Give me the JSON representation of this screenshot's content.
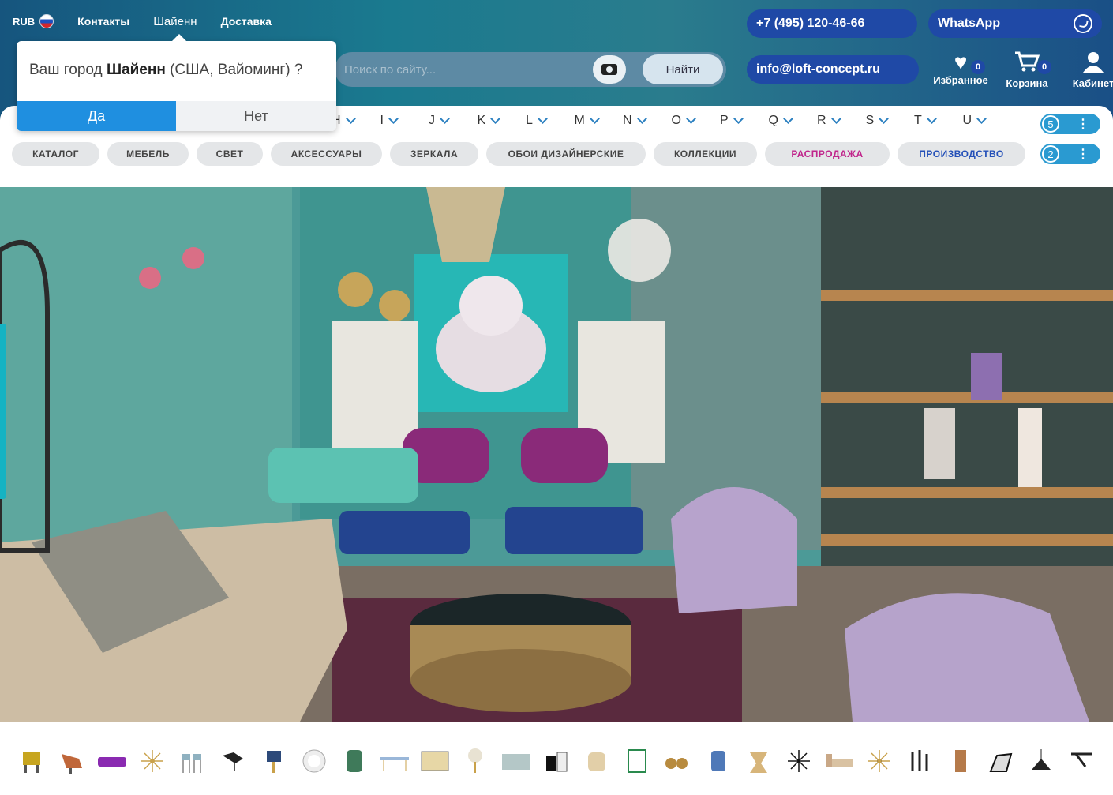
{
  "topnav": {
    "currency": "RUB",
    "links": [
      "Контакты",
      "Шайенн",
      "Доставка"
    ]
  },
  "contacts": {
    "phone": "+7 (495) 120-46-66",
    "whatsapp": "WhatsApp",
    "email": "info@loft-concept.ru"
  },
  "search": {
    "placeholder": "Поиск по сайту...",
    "button": "Найти"
  },
  "user_icons": [
    {
      "label": "Избранное",
      "count": "0",
      "icon": "heart-icon"
    },
    {
      "label": "Корзина",
      "count": "0",
      "icon": "cart-icon"
    },
    {
      "label": "Кабинет",
      "icon": "user-icon"
    }
  ],
  "city_popup": {
    "prefix": "Ваш город ",
    "city": "Шайенн",
    "suffix": " (США, Вайоминг) ?",
    "yes": "Да",
    "no": "Нет"
  },
  "letters": [
    "H",
    "I",
    "J",
    "K",
    "L",
    "M",
    "N",
    "O",
    "P",
    "Q",
    "R",
    "S",
    "T",
    "U"
  ],
  "letters_more": "5",
  "categories": [
    "КАТАЛОГ",
    "МЕБЕЛЬ",
    "СВЕТ",
    "АКСЕССУАРЫ",
    "ЗЕРКАЛА",
    "ОБОИ ДИЗАЙНЕРСКИЕ",
    "КОЛЛЕКЦИИ",
    "РАСПРОДАЖА",
    "ПРОИЗВОДСТВО"
  ],
  "categories_more": "2",
  "colors": {
    "accent_blue": "#1f49a6",
    "popup_yes": "#1f8fe0",
    "sale": "#c0268c",
    "production": "#2450b8"
  }
}
